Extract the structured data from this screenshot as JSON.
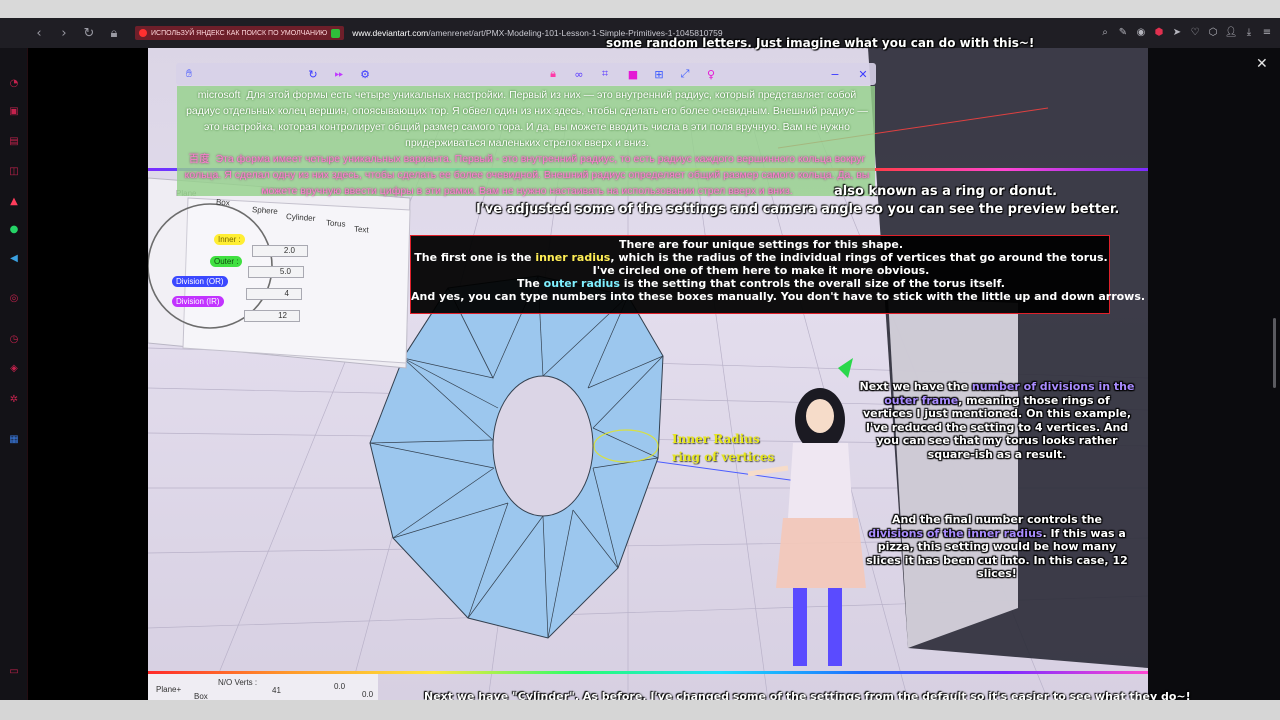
{
  "browser": {
    "yandex_banner": "ИСПОЛЬЗУЙ ЯНДЕКС КАК ПОИСК ПО УМОЛЧАНИЮ",
    "url_domain": "www.deviantart.com",
    "url_path": "/amenrenet/art/PMX-Modeling-101-Lesson-1-Simple-Primitives-1-1045810759"
  },
  "translation": {
    "ms_source": "microsoft",
    "ms_text": "Для этой формы есть четыре уникальных настройки. Первый из них — это внутренний радиус, который представляет собой радиус отдельных колец вершин, опоясывающих тор. Я обвел один из них здесь, чтобы сделать его более очевидным. Внешний радиус — это настройка, которая контролирует общий размер самого тора. И да, вы можете вводить числа в эти поля вручную. Вам не нужно придерживаться маленьких стрелок вверх и вниз.",
    "baidu_source": "百度",
    "baidu_text": "Эта форма имеет четыре уникальных варианта. Первый - это внутренний радиус, то есть радиус каждого вершинного кольца вокруг кольца. Я сделал одну из них здесь, чтобы сделать ее более очевидной. Внешний радиус определяет общий размер самого кольца. Да, вы можете вручную ввести цифры в эти рамки. Вам не нужно настаивать на использовании стрел вверх и вниз."
  },
  "captions": {
    "top_partial": "some random letters. Just imagine what you can do with this~!",
    "ring_tail": "also known as a ring or donut.",
    "adjusted": "I've adjusted some of the settings and camera angle so you can see the preview better.",
    "box_line1": "There are four unique settings for this shape.",
    "box_line2_a": "The first one is the ",
    "box_line2_hl": "inner radius",
    "box_line2_b": ", which is the radius of the individual rings of vertices that go around the torus.",
    "box_line3": "I've circled one of them here to make it more obvious.",
    "box_line4_a": "The ",
    "box_line4_hl": "outer radius",
    "box_line4_b": " is the setting that controls the overall size of the torus itself.",
    "box_line5": "And yes, you can type numbers into these boxes manually. You don't have to stick with the little up and down arrows.",
    "div_a": "Next we have the ",
    "div_hl": "number of divisions in the outer frame",
    "div_b": ", meaning those rings of vertices I just mentioned. On this example, I've reduced the setting to 4 vertices. And you can see that my torus looks rather square-ish as a result.",
    "final_a": "And the final number controls the ",
    "final_hl": "divisions of the inner radius",
    "final_b": ". If this was a pizza, this setting would be how many slices it has been cut into. In this case, 12 slices!",
    "bottom": "Next we have \"Cylinder\". As before, I've changed some of the settings from the default so it's easier to see what they do~!"
  },
  "annotations": {
    "inner_radius_line1": "Inner  Radius",
    "inner_radius_line2": "ring  of  vertices"
  },
  "panel": {
    "tab_plane": "Plane",
    "tab_box": "Box",
    "tab_sphere": "Sphere",
    "tab_cylinder": "Cylinder",
    "tab_torus": "Torus",
    "tab_text": "Text",
    "label_inner": "Inner :",
    "label_outer": "Outer :",
    "label_division_or": "Division (OR)",
    "label_division_ir": "Division (IR)",
    "value_inner": "2.0",
    "value_outer": "5.0",
    "value_division_or": "4",
    "value_division_ir": "12",
    "bottom_tab_plane": "Plane+",
    "bottom_tab_box": "Box",
    "bottom_label_nverts": "N/O Verts :",
    "bottom_value_nverts": "41",
    "bottom_value_a": "0.0",
    "bottom_value_b": "0.0"
  },
  "colors": {
    "accent": "#c4224d",
    "highlight_yellow": "#ffee55",
    "highlight_cyan": "#7ff0ff",
    "highlight_purple": "#a98cff",
    "torus_fill": "#9cc7ee"
  }
}
